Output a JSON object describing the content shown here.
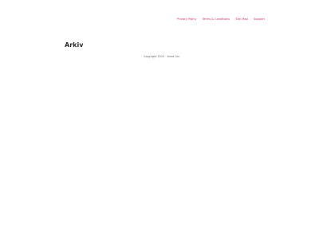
{
  "nav": {
    "items": [
      {
        "label": "Privacy Policy"
      },
      {
        "label": "Terms & Conditions"
      },
      {
        "label": "Site Map"
      },
      {
        "label": "Support"
      }
    ],
    "link_color": "#e0245e"
  },
  "page": {
    "title": "Arkiv",
    "copyright": "Copyright 2022 · Anna Lim"
  }
}
